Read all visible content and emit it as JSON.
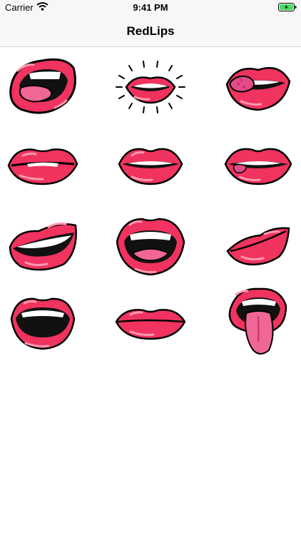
{
  "status_bar": {
    "carrier": "Carrier",
    "time": "9:41 PM"
  },
  "nav": {
    "title": "RedLips"
  },
  "stickers": [
    {
      "name": "tongue-out-lips"
    },
    {
      "name": "sparkle-smile-lips"
    },
    {
      "name": "lick-lips"
    },
    {
      "name": "bite-lip"
    },
    {
      "name": "teeth-smile-lips"
    },
    {
      "name": "tongue-bite-lips"
    },
    {
      "name": "smirk-lips"
    },
    {
      "name": "open-mouth-lips"
    },
    {
      "name": "kiss-lips"
    },
    {
      "name": "grin-lips"
    },
    {
      "name": "closed-lips"
    },
    {
      "name": "big-tongue-lips"
    }
  ],
  "colors": {
    "lip": "#f0335f",
    "lip_shine": "#ff98ae",
    "tongue": "#f06796",
    "outline": "#000000"
  }
}
